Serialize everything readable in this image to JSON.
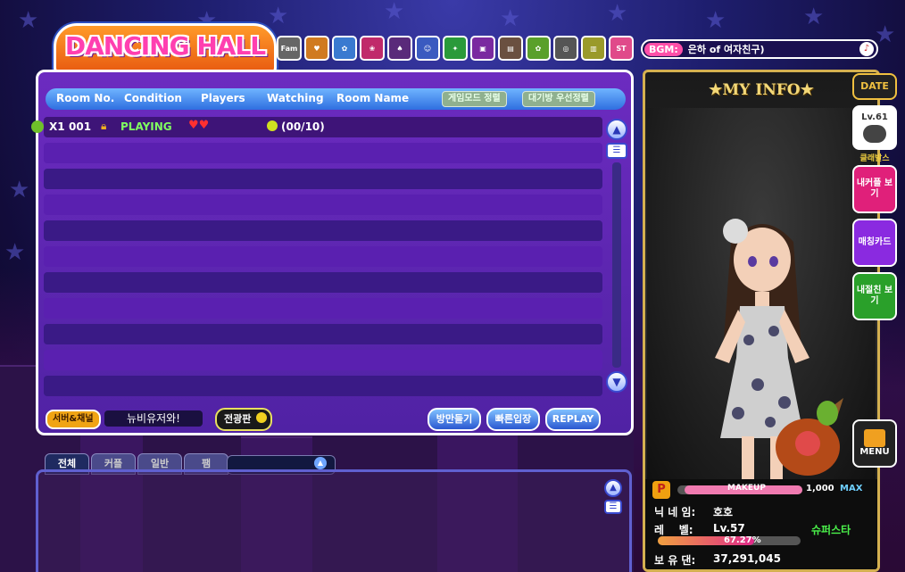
{
  "logo": {
    "text": "DANCING HALL"
  },
  "toolbar": {
    "icons": [
      "family-icon",
      "couple-icon",
      "club-icon",
      "gift-icon",
      "shop-icon",
      "community-icon",
      "event-icon",
      "box-icon",
      "photo-icon",
      "garden-icon",
      "ring-icon",
      "book-icon",
      "story-icon"
    ]
  },
  "bgm": {
    "label": "BGM:",
    "song": "은하 of 여자친구)"
  },
  "room_list": {
    "columns": [
      "Room No.",
      "Condition",
      "Players",
      "Watching",
      "Room Name"
    ],
    "mode_sort_label": "게임모드 정렬",
    "wait_sort_label": "대기방 우선정렬",
    "rows": [
      {
        "multiplier": "X1",
        "room_no": "001",
        "condition": "PLAYING",
        "watching": "(00/10)"
      }
    ],
    "empty_rows": 10
  },
  "bottom": {
    "server_label": "서버&채널",
    "server_name": "뉴비유저와!",
    "broadcast_label": "전광판",
    "create_room_label": "방만들기",
    "quick_join_label": "빠른입장",
    "replay_label": "REPLAY"
  },
  "chat": {
    "tabs": [
      "전체",
      "커플",
      "일반",
      "팸"
    ]
  },
  "myinfo": {
    "title": "★MY INFO★",
    "makeup_label": "MAKEUP",
    "makeup_value": "1,000",
    "makeup_max": "MAX",
    "nickname_label": "닉 네 임:",
    "nickname": "호호",
    "level_label": "레    벨:",
    "level": "Lv.57",
    "title_badge": "슈퍼스타",
    "exp_percent": "67.27%",
    "money_label": "보 유 댄:",
    "money": "37,291,045",
    "exp_fraction": 0.6727
  },
  "side": {
    "date_label": "DATE",
    "level_badge": "Lv.61",
    "heart_label": "클래발스",
    "couple_label": "내커플 보기",
    "matching_label": "매칭카드",
    "bff_label": "내절친 보기",
    "menu_label": "MENU"
  },
  "colors": {
    "accent": "#ff4fa8",
    "panel": "#5a20b0",
    "gold": "#f3d878"
  }
}
